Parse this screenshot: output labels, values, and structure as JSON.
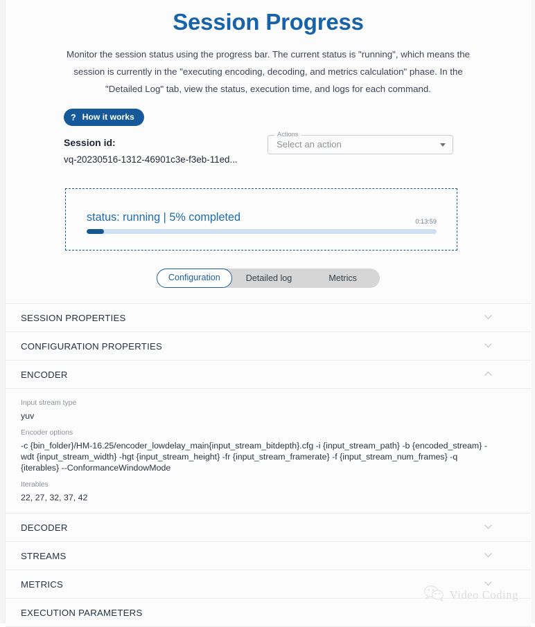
{
  "header": {
    "title": "Session Progress",
    "description": "Monitor the session status using the progress bar. The current status is \"running\", which means the session is currently in the \"executing encoding, decoding, and metrics calculation\" phase. In the \"Detailed Log\" tab, view the status, execution time, and logs for each command."
  },
  "how_it_works": {
    "icon": "question-mark-icon",
    "label": "How it works"
  },
  "session": {
    "id_label": "Session id:",
    "id_value": "vq-20230516-1312-46901c3e-f3eb-11ed..."
  },
  "actions_select": {
    "legend": "Actions",
    "value": "Select an action",
    "arrow_icon": "chevron-down-icon"
  },
  "progress": {
    "status_text": "status: running | 5% completed",
    "status": "running",
    "percent": 5,
    "percent_label": "5% completed",
    "timer": "0:13:59"
  },
  "tabs": [
    {
      "label": "Configuration",
      "active": true
    },
    {
      "label": "Detailed log",
      "active": false
    },
    {
      "label": "Metrics",
      "active": false
    }
  ],
  "accordions": [
    {
      "title": "SESSION PROPERTIES",
      "expanded": false,
      "chevron": "chevron-down-icon"
    },
    {
      "title": "CONFIGURATION PROPERTIES",
      "expanded": false,
      "chevron": "chevron-down-icon"
    },
    {
      "title": "ENCODER",
      "expanded": true,
      "chevron": "chevron-up-icon"
    },
    {
      "title": "DECODER",
      "expanded": false,
      "chevron": "chevron-down-icon"
    },
    {
      "title": "STREAMS",
      "expanded": false,
      "chevron": "chevron-down-icon"
    },
    {
      "title": "METRICS",
      "expanded": false,
      "chevron": "chevron-down-icon"
    },
    {
      "title": "EXECUTION PARAMETERS",
      "expanded": false,
      "chevron": "chevron-down-icon"
    }
  ],
  "encoder": {
    "input_stream_type_label": "Input stream type",
    "input_stream_type_value": "yuv",
    "encoder_options_label": "Encoder options",
    "encoder_options_value": "-c {bin_folder}/HM-16.25/encoder_lowdelay_main{input_stream_bitdepth}.cfg -i {input_stream_path} -b {encoded_stream} -wdt {input_stream_width} -hgt {input_stream_height} -fr {input_stream_framerate} -f {input_stream_num_frames} -q {iterables} --ConformanceWindowMode",
    "iterables_label": "Iterables",
    "iterables_value": "22, 27, 32, 37, 42"
  },
  "watermark": {
    "icon": "wechat-logo-icon",
    "text": "Video Coding"
  },
  "colors": {
    "title_blue": "#1762a8",
    "button_blue": "#15599b",
    "progress_fill": "#15578f",
    "progress_track": "#cfe0f2",
    "panel_border": "#17589a",
    "status_blue": "#1a6bb0",
    "tab_active_border": "#1a5e9e",
    "tabs_background": "#d6d6d6"
  }
}
